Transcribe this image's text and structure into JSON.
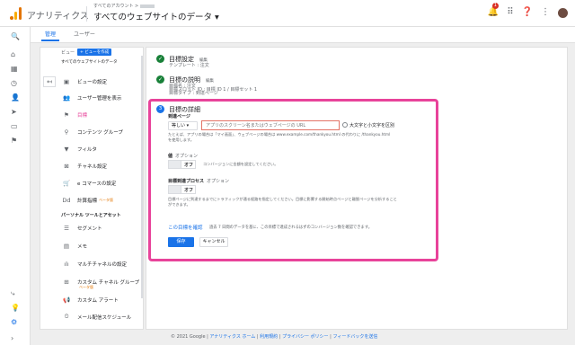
{
  "header": {
    "app_name": "アナリティクス",
    "account_label": "すべてのアカウント >",
    "property_label": "すべてのウェブサイトのデータ ▾",
    "notification_count": "1"
  },
  "tabs": {
    "admin": "管理",
    "user": "ユーザー"
  },
  "sidebar": {
    "view_label": "ビュー",
    "create_view_button": "+ ビューを作成",
    "view_name": "すべてのウェブサイトのデータ",
    "items": [
      {
        "label": "ビューの設定",
        "icon": "view-settings-icon"
      },
      {
        "label": "ユーザー管理を表示",
        "icon": "users-icon"
      },
      {
        "label": "目標",
        "icon": "flag-icon"
      },
      {
        "label": "コンテンツ グループ",
        "icon": "content-group-icon"
      },
      {
        "label": "フィルタ",
        "icon": "filter-icon"
      },
      {
        "label": "チャネル設定",
        "icon": "channel-icon"
      },
      {
        "label": "e コマースの設定",
        "icon": "cart-icon"
      },
      {
        "label": "計算指標",
        "icon": "calc-icon",
        "beta": "ベータ版"
      }
    ],
    "personal_tools_heading": "パーソナル ツールとアセット",
    "personal_items": [
      {
        "label": "セグメント",
        "icon": "segment-icon"
      },
      {
        "label": "メモ",
        "icon": "memo-icon"
      },
      {
        "label": "マルチチャネルの設定",
        "icon": "multichannel-icon"
      },
      {
        "label": "カスタム チャネル グループ",
        "icon": "custom-channel-icon",
        "beta": "ベータ版"
      },
      {
        "label": "カスタム アラート",
        "icon": "alert-icon"
      },
      {
        "label": "メール配信スケジュール",
        "icon": "schedule-icon"
      }
    ]
  },
  "steps": {
    "goal_setup": {
      "title": "目標設定",
      "edit": "編集",
      "line1": "テンプレート : 注文"
    },
    "goal_description": {
      "title": "目標の説明",
      "edit": "編集",
      "line1": "目標名 : 注文",
      "line2": "目標スロット ID : 目標 ID 1 / 目標セット 1",
      "line3": "目標タイプ : 到達ページ"
    },
    "goal_details": {
      "step_number": "3",
      "title": "目標の詳細",
      "destination_label": "到達ページ",
      "match_type": "等しい ▾",
      "url_placeholder": "アプリのスクリーン名またはウェブページの URL",
      "case_sensitive_label": "大文字と小文字を区別",
      "destination_help": "たとえば、アプリの場合は「マイ画面」、ウェブページの場合は www.example.com/thankyou.html の代わりに /thankyou.html を使用します。",
      "value_label": "値",
      "value_optional": "オプション",
      "value_toggle": "オフ",
      "value_help": "コンバージョンに金額を設定してください。",
      "funnel_label": "目標到達プロセス",
      "funnel_optional": "オプション",
      "funnel_toggle": "オフ",
      "funnel_help": "目標ページに到達するまでにトラフィックが通る経路を指定してください。目標に影響する開始時点ページと離脱ページを分析することができます。",
      "verify_link": "この目標を確認",
      "verify_desc": "過去 7 日間のデータを基に、この目標で達成されるはずのコンバージョン数を確認できます。",
      "save": "保存",
      "cancel": "キャンセル"
    }
  },
  "footer": {
    "copyright": "© 2021 Google |",
    "links": [
      "アナリティクス ホーム",
      "利用規約",
      "プライバシー ポリシー",
      "フィードバックを送信"
    ]
  },
  "colors": {
    "accent": "#1a73e8",
    "highlight": "#e8439a",
    "check": "#188038"
  }
}
